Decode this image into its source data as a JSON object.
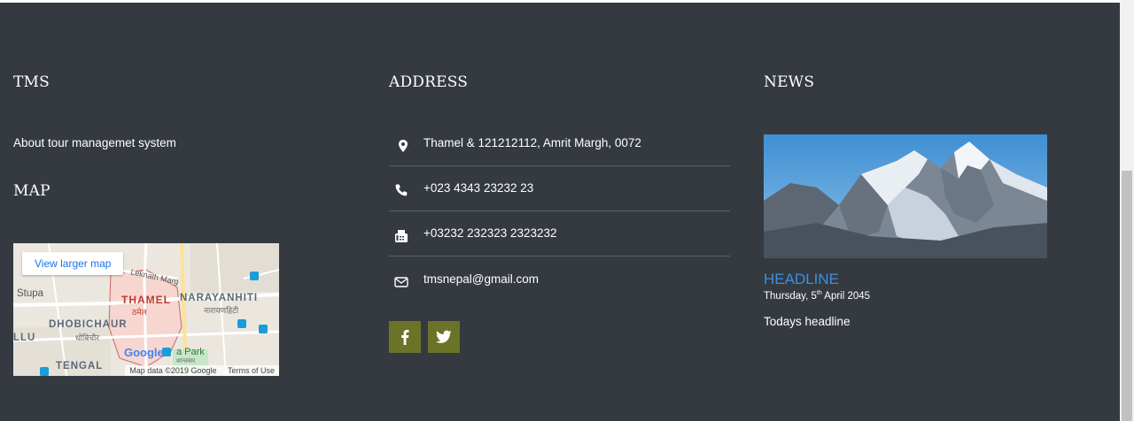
{
  "tms": {
    "heading": "TMS",
    "about_link": "About tour managemet system"
  },
  "map_section": {
    "heading": "MAP",
    "view_larger": "View larger map",
    "labels": {
      "stupa": "Stupa",
      "thamel": "THAMEL",
      "thamel_local": "ठमेल",
      "narayanhiti": "NARAYANHITI",
      "narayanhiti_local": "नारायणहिटी",
      "dhobichaur": "DHOBICHAUR",
      "dhobichaur_local": "धोबिचौर",
      "llu": "LLU",
      "tenga": "TENGAL",
      "leknath": "Leknath Marg",
      "park": "a Park",
      "park_local": "शान्तवार"
    },
    "google": "Google",
    "attribution": "Map data ©2019 Google",
    "terms": "Terms of Use"
  },
  "address": {
    "heading": "ADDRESS",
    "items": [
      {
        "icon": "location-pin-icon",
        "text": "Thamel & 121212112, Amrit Margh, 0072"
      },
      {
        "icon": "phone-icon",
        "text": "+023 4343 23232 23"
      },
      {
        "icon": "fax-icon",
        "text": "+03232 232323 2323232"
      },
      {
        "icon": "envelope-icon",
        "text": "tmsnepal@gmail.com"
      }
    ],
    "social": [
      {
        "icon": "facebook-icon"
      },
      {
        "icon": "twitter-icon"
      }
    ]
  },
  "news": {
    "heading": "NEWS",
    "headline": "HEADLINE",
    "date_prefix": "Thursday, 5",
    "date_sup": "th",
    "date_suffix": " April 2045",
    "text": "Todays headline"
  },
  "colors": {
    "footer_bg": "#343a40",
    "headline": "#3d8fe0",
    "social_bg": "#6b7327"
  }
}
